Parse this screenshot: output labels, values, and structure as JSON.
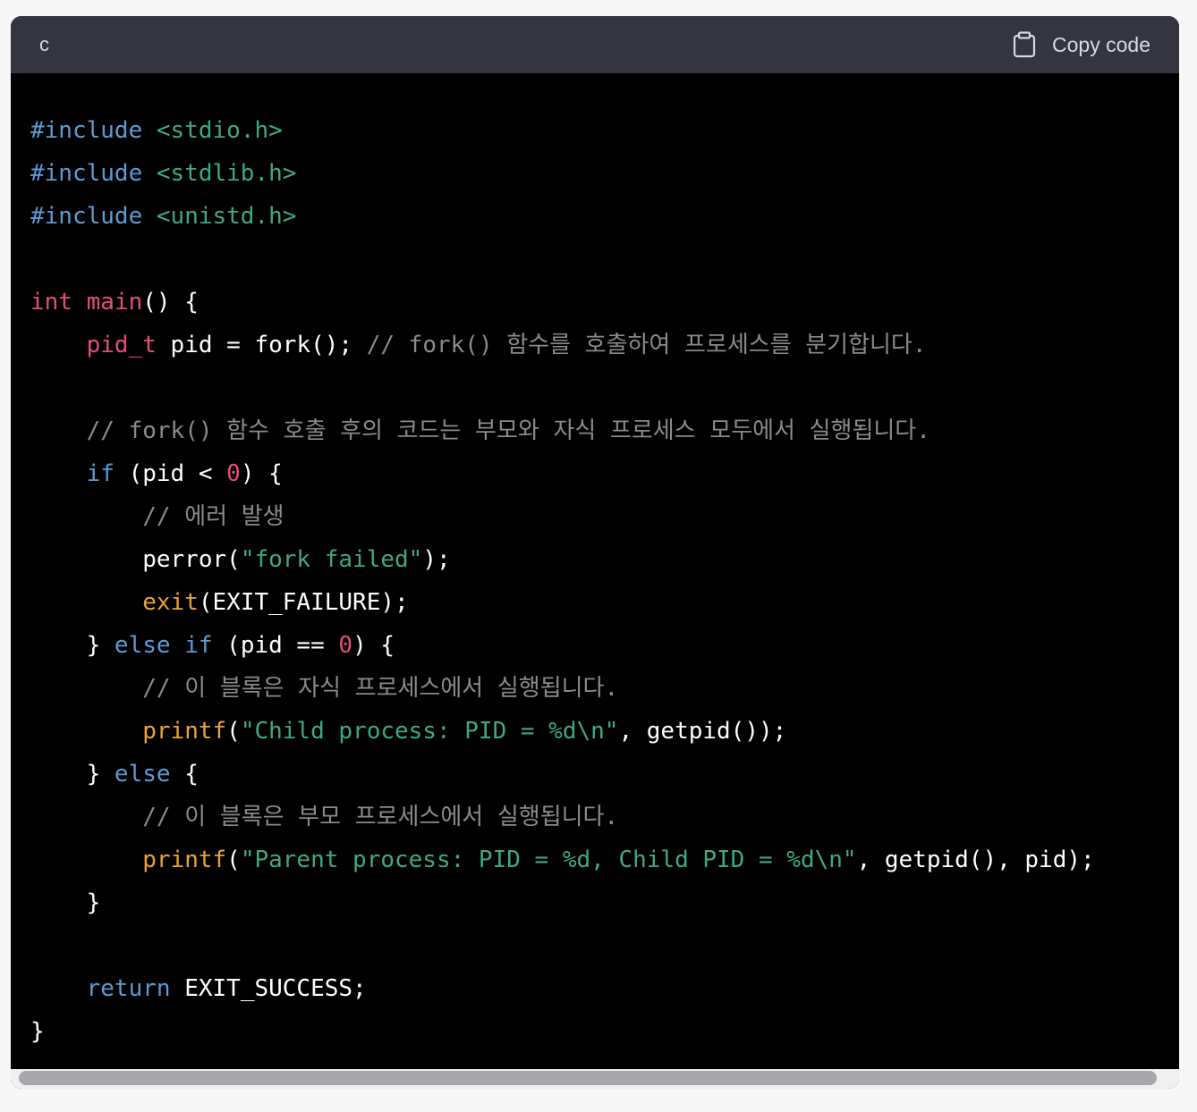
{
  "header": {
    "language": "c",
    "copy_label": "Copy code",
    "copy_icon": "clipboard-icon"
  },
  "code": {
    "lines": [
      [
        {
          "t": "include",
          "v": "#include"
        },
        {
          "t": "plain",
          "v": " "
        },
        {
          "t": "header",
          "v": "<stdio.h>"
        }
      ],
      [
        {
          "t": "include",
          "v": "#include"
        },
        {
          "t": "plain",
          "v": " "
        },
        {
          "t": "header",
          "v": "<stdlib.h>"
        }
      ],
      [
        {
          "t": "include",
          "v": "#include"
        },
        {
          "t": "plain",
          "v": " "
        },
        {
          "t": "header",
          "v": "<unistd.h>"
        }
      ],
      [],
      [
        {
          "t": "type",
          "v": "int"
        },
        {
          "t": "plain",
          "v": " "
        },
        {
          "t": "fn-red",
          "v": "main"
        },
        {
          "t": "plain",
          "v": "() {"
        }
      ],
      [
        {
          "t": "plain",
          "v": "    "
        },
        {
          "t": "type",
          "v": "pid_t"
        },
        {
          "t": "plain",
          "v": " pid = fork(); "
        },
        {
          "t": "comment",
          "v": "// fork() 함수를 호출하여 프로세스를 분기합니다."
        }
      ],
      [],
      [
        {
          "t": "plain",
          "v": "    "
        },
        {
          "t": "comment",
          "v": "// fork() 함수 호출 후의 코드는 부모와 자식 프로세스 모두에서 실행됩니다."
        }
      ],
      [
        {
          "t": "plain",
          "v": "    "
        },
        {
          "t": "kw",
          "v": "if"
        },
        {
          "t": "plain",
          "v": " (pid < "
        },
        {
          "t": "num",
          "v": "0"
        },
        {
          "t": "plain",
          "v": ") {"
        }
      ],
      [
        {
          "t": "plain",
          "v": "        "
        },
        {
          "t": "comment",
          "v": "// 에러 발생"
        }
      ],
      [
        {
          "t": "plain",
          "v": "        perror("
        },
        {
          "t": "str",
          "v": "\"fork failed\""
        },
        {
          "t": "plain",
          "v": ");"
        }
      ],
      [
        {
          "t": "plain",
          "v": "        "
        },
        {
          "t": "fn-gold",
          "v": "exit"
        },
        {
          "t": "plain",
          "v": "(EXIT_FAILURE);"
        }
      ],
      [
        {
          "t": "plain",
          "v": "    } "
        },
        {
          "t": "kw",
          "v": "else"
        },
        {
          "t": "plain",
          "v": " "
        },
        {
          "t": "kw",
          "v": "if"
        },
        {
          "t": "plain",
          "v": " (pid == "
        },
        {
          "t": "num",
          "v": "0"
        },
        {
          "t": "plain",
          "v": ") {"
        }
      ],
      [
        {
          "t": "plain",
          "v": "        "
        },
        {
          "t": "comment",
          "v": "// 이 블록은 자식 프로세스에서 실행됩니다."
        }
      ],
      [
        {
          "t": "plain",
          "v": "        "
        },
        {
          "t": "fn-gold",
          "v": "printf"
        },
        {
          "t": "plain",
          "v": "("
        },
        {
          "t": "str",
          "v": "\"Child process: PID = %d\\n\""
        },
        {
          "t": "plain",
          "v": ", getpid());"
        }
      ],
      [
        {
          "t": "plain",
          "v": "    } "
        },
        {
          "t": "kw",
          "v": "else"
        },
        {
          "t": "plain",
          "v": " {"
        }
      ],
      [
        {
          "t": "plain",
          "v": "        "
        },
        {
          "t": "comment",
          "v": "// 이 블록은 부모 프로세스에서 실행됩니다."
        }
      ],
      [
        {
          "t": "plain",
          "v": "        "
        },
        {
          "t": "fn-gold",
          "v": "printf"
        },
        {
          "t": "plain",
          "v": "("
        },
        {
          "t": "str",
          "v": "\"Parent process: PID = %d, Child PID = %d\\n\""
        },
        {
          "t": "plain",
          "v": ", getpid(), pid);"
        }
      ],
      [
        {
          "t": "plain",
          "v": "    }"
        }
      ],
      [],
      [
        {
          "t": "plain",
          "v": "    "
        },
        {
          "t": "kw",
          "v": "return"
        },
        {
          "t": "plain",
          "v": " EXIT_SUCCESS;"
        }
      ],
      [
        {
          "t": "plain",
          "v": "}"
        }
      ]
    ]
  },
  "colors": {
    "header_bg": "#343541",
    "code_bg": "#000000",
    "keyword": "#5b9bd5",
    "string": "#3fa883",
    "type": "#e34d79",
    "function_call": "#e6a23c",
    "comment": "#8a8a8a"
  }
}
